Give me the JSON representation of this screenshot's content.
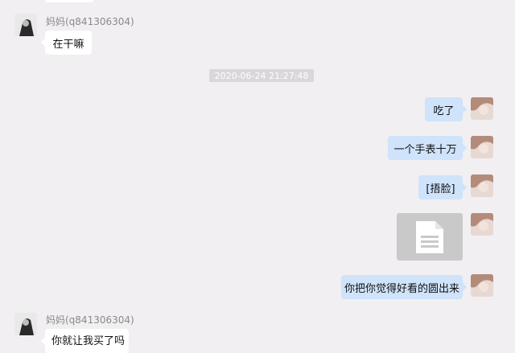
{
  "chat": {
    "sender_name": "妈妈(q841306304)",
    "timestamp": "2020-06-24 21:27:48",
    "messages": [
      {
        "direction": "in",
        "text": "在干嘛"
      },
      {
        "direction": "out",
        "text": "吃了"
      },
      {
        "direction": "out",
        "text": "一个手表十万"
      },
      {
        "direction": "out",
        "text": "[捂脸]"
      },
      {
        "direction": "out",
        "type": "file",
        "icon": "document-icon"
      },
      {
        "direction": "out",
        "text": "你把你觉得好看的圆出来"
      },
      {
        "direction": "in",
        "text": "你就让我买了吗"
      }
    ]
  },
  "colors": {
    "background": "#f1eff1",
    "incoming_bubble": "#ffffff",
    "outgoing_bubble": "#cfe3fb",
    "timestamp_bg": "#d9d7d9",
    "file_card": "#c9c9c9"
  }
}
